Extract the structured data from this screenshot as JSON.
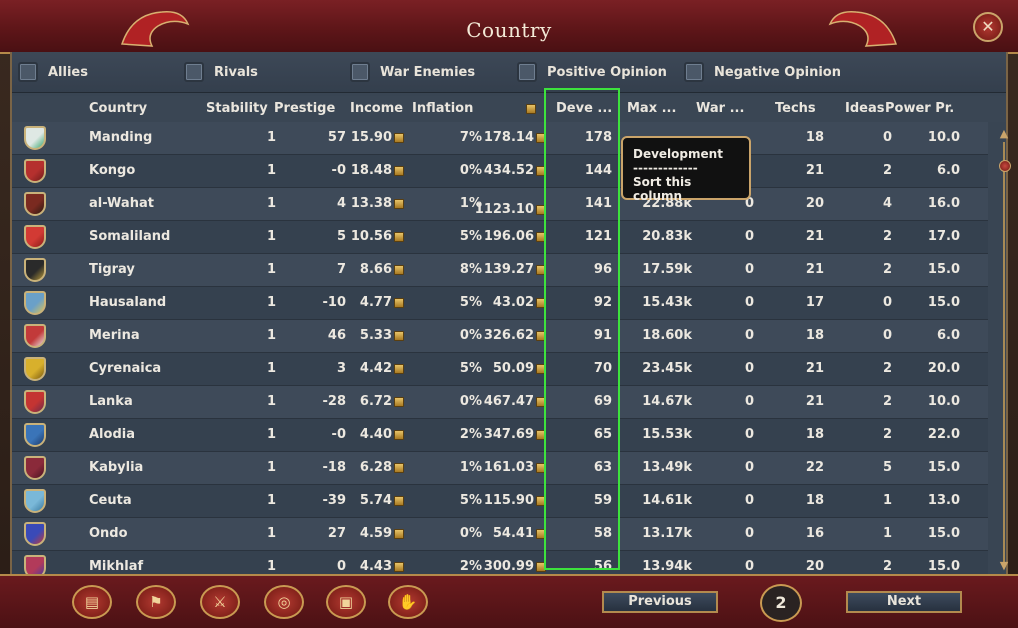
{
  "window": {
    "title": "Country",
    "close_icon": "close-icon"
  },
  "filters": [
    {
      "label": "Allies"
    },
    {
      "label": "Rivals"
    },
    {
      "label": "War Enemies"
    },
    {
      "label": "Positive Opinion"
    },
    {
      "label": "Negative Opinion"
    }
  ],
  "columns": {
    "country": "Country",
    "stability": "Stability",
    "prestige": "Prestige",
    "income": "Income",
    "inflation": "Inflation",
    "treasury_icon": "gold-coin-icon",
    "development": "Deve ...",
    "max_manpower": "Max ...",
    "war": "War ...",
    "techs": "Techs",
    "ideas": "Ideas",
    "power": "Power Pr."
  },
  "tooltip": {
    "title": "Development",
    "divider": "-------------",
    "hint": "Sort this column"
  },
  "rows": [
    {
      "name": "Manding",
      "stability": "1",
      "prestige": "57",
      "income": "15.90",
      "inflation": "7%",
      "treasury": "178.14",
      "dev": "178",
      "manpower": "",
      "war": "",
      "techs": "18",
      "ideas": "0",
      "power": "10.0",
      "shield": "#dfe8e4",
      "shield2": "#3aa870"
    },
    {
      "name": "Kongo",
      "stability": "1",
      "prestige": "-0",
      "income": "18.48",
      "inflation": "0%",
      "treasury": "434.52",
      "dev": "144",
      "manpower": "",
      "war": "",
      "techs": "21",
      "ideas": "2",
      "power": "6.0",
      "shield": "#b5302e",
      "shield2": "#6e1b1a"
    },
    {
      "name": "al-Wahat",
      "stability": "1",
      "prestige": "4",
      "income": "13.38",
      "inflation": "1%",
      "treasury": "1123.10",
      "dev": "141",
      "manpower": "22.88k",
      "war": "0",
      "techs": "20",
      "ideas": "4",
      "power": "16.0",
      "shield": "#7a2a20",
      "shield2": "#2b1a12"
    },
    {
      "name": "Somaliland",
      "stability": "1",
      "prestige": "5",
      "income": "10.56",
      "inflation": "5%",
      "treasury": "196.06",
      "dev": "121",
      "manpower": "20.83k",
      "war": "0",
      "techs": "21",
      "ideas": "2",
      "power": "17.0",
      "shield": "#d23a34",
      "shield2": "#8a1c18"
    },
    {
      "name": "Tigray",
      "stability": "1",
      "prestige": "7",
      "income": "8.66",
      "inflation": "8%",
      "treasury": "139.27",
      "dev": "96",
      "manpower": "17.59k",
      "war": "0",
      "techs": "21",
      "ideas": "2",
      "power": "15.0",
      "shield": "#2a2a2a",
      "shield2": "#b89a3a"
    },
    {
      "name": "Hausaland",
      "stability": "1",
      "prestige": "-10",
      "income": "4.77",
      "inflation": "5%",
      "treasury": "43.02",
      "dev": "92",
      "manpower": "15.43k",
      "war": "0",
      "techs": "17",
      "ideas": "0",
      "power": "15.0",
      "shield": "#6aa0c8",
      "shield2": "#d6c25a"
    },
    {
      "name": "Merina",
      "stability": "1",
      "prestige": "46",
      "income": "5.33",
      "inflation": "0%",
      "treasury": "326.62",
      "dev": "91",
      "manpower": "18.60k",
      "war": "0",
      "techs": "18",
      "ideas": "0",
      "power": "6.0",
      "shield": "#c23a3a",
      "shield2": "#e8e0e0"
    },
    {
      "name": "Cyrenaica",
      "stability": "1",
      "prestige": "3",
      "income": "4.42",
      "inflation": "5%",
      "treasury": "50.09",
      "dev": "70",
      "manpower": "23.45k",
      "war": "0",
      "techs": "21",
      "ideas": "2",
      "power": "20.0",
      "shield": "#d8b02c",
      "shield2": "#7a5a10"
    },
    {
      "name": "Lanka",
      "stability": "1",
      "prestige": "-28",
      "income": "6.72",
      "inflation": "0%",
      "treasury": "467.47",
      "dev": "69",
      "manpower": "14.67k",
      "war": "0",
      "techs": "21",
      "ideas": "2",
      "power": "10.0",
      "shield": "#c43432",
      "shield2": "#6a2a4a"
    },
    {
      "name": "Alodia",
      "stability": "1",
      "prestige": "-0",
      "income": "4.40",
      "inflation": "2%",
      "treasury": "347.69",
      "dev": "65",
      "manpower": "15.53k",
      "war": "0",
      "techs": "18",
      "ideas": "2",
      "power": "22.0",
      "shield": "#3a74b8",
      "shield2": "#1c3a6a"
    },
    {
      "name": "Kabylia",
      "stability": "1",
      "prestige": "-18",
      "income": "6.28",
      "inflation": "1%",
      "treasury": "161.03",
      "dev": "63",
      "manpower": "13.49k",
      "war": "0",
      "techs": "22",
      "ideas": "5",
      "power": "15.0",
      "shield": "#8a2a3a",
      "shield2": "#4a1222"
    },
    {
      "name": "Ceuta",
      "stability": "1",
      "prestige": "-39",
      "income": "5.74",
      "inflation": "5%",
      "treasury": "115.90",
      "dev": "59",
      "manpower": "14.61k",
      "war": "0",
      "techs": "18",
      "ideas": "1",
      "power": "13.0",
      "shield": "#7ab8d8",
      "shield2": "#3a7aa0"
    },
    {
      "name": "Ondo",
      "stability": "1",
      "prestige": "27",
      "income": "4.59",
      "inflation": "0%",
      "treasury": "54.41",
      "dev": "58",
      "manpower": "13.17k",
      "war": "0",
      "techs": "16",
      "ideas": "1",
      "power": "15.0",
      "shield": "#3a4ab8",
      "shield2": "#c23a3a"
    },
    {
      "name": "Mikhlaf",
      "stability": "1",
      "prestige": "0",
      "income": "4.43",
      "inflation": "2%",
      "treasury": "300.99",
      "dev": "56",
      "manpower": "13.94k",
      "war": "0",
      "techs": "20",
      "ideas": "2",
      "power": "15.0",
      "shield": "#b23a5a",
      "shield2": "#4a3aa0"
    }
  ],
  "bottom": {
    "buttons": [
      {
        "icon": "ledger-icon",
        "glyph": "▤"
      },
      {
        "icon": "flag-icon",
        "glyph": "⚑"
      },
      {
        "icon": "crossed-swords-icon",
        "glyph": "⚔"
      },
      {
        "icon": "coins-icon",
        "glyph": "◎"
      },
      {
        "icon": "trade-goods-icon",
        "glyph": "▣"
      },
      {
        "icon": "handshake-icon",
        "glyph": "✋"
      }
    ],
    "previous": "Previous",
    "page": "2",
    "next": "Next"
  }
}
